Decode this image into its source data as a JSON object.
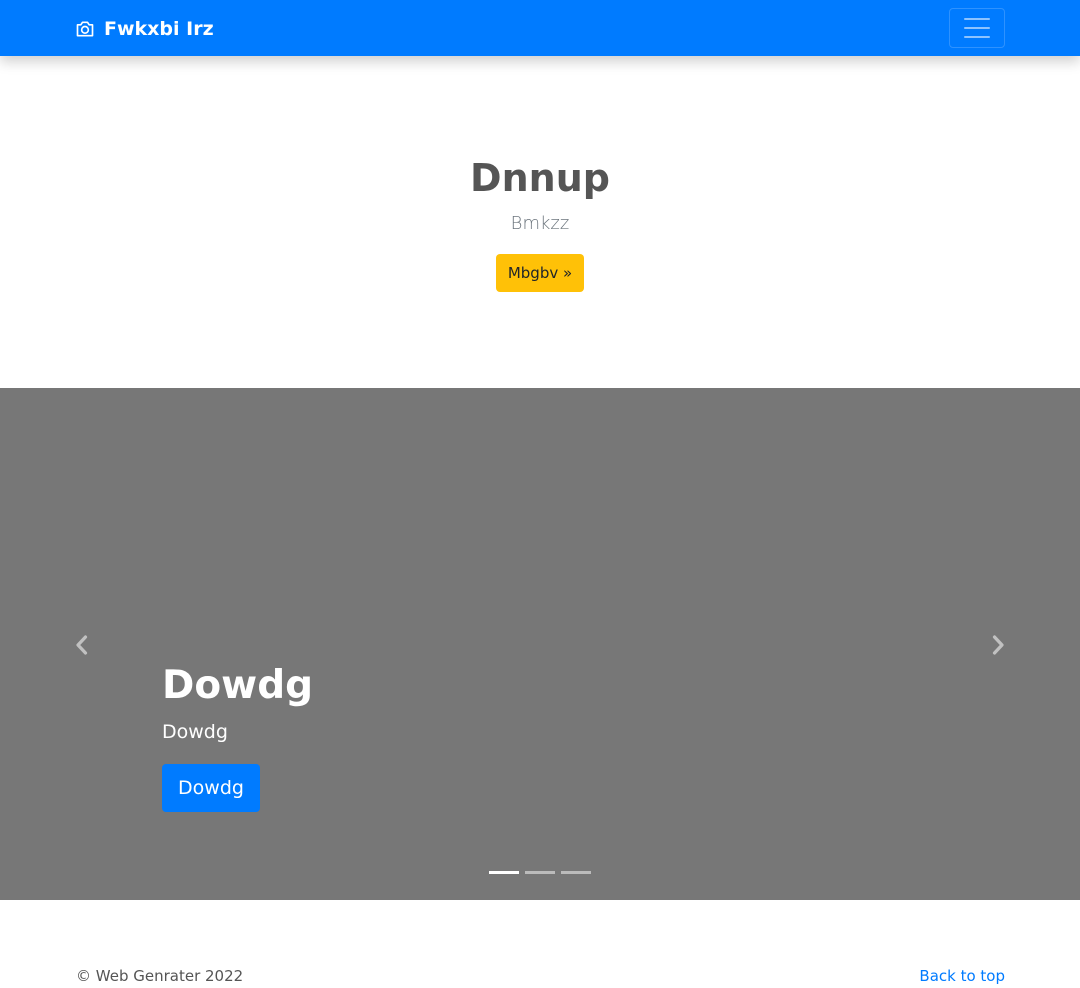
{
  "navbar": {
    "brand_label": "Fwkxbi Irz",
    "brand_icon": "camera-icon",
    "toggler_icon": "hamburger-menu-icon",
    "color": "#007bff"
  },
  "hero": {
    "title": "Dnnup",
    "subtitle": "Bmkzz",
    "button_label": "Mbgbv »",
    "button_color": "#ffc107"
  },
  "carousel": {
    "background": "#777777",
    "prev_icon": "chevron-left-icon",
    "next_icon": "chevron-right-icon",
    "slide": {
      "title": "Dowdg",
      "text": "Dowdg",
      "button_label": "Dowdg",
      "button_color": "#007bff"
    },
    "indicator_count": 3,
    "active_index": 0
  },
  "footer": {
    "copyright": "© Web Genrater 2022",
    "back_to_top": "Back to top"
  }
}
